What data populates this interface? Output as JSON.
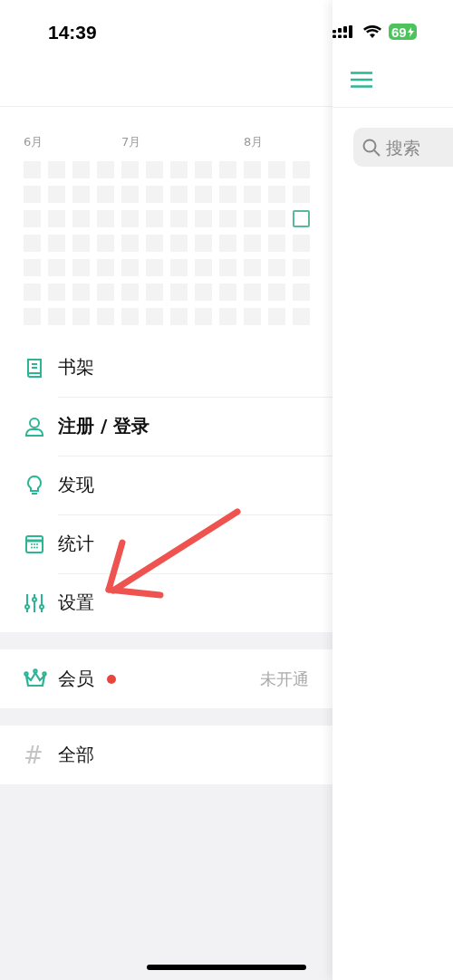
{
  "status_bar": {
    "time": "14:39",
    "battery": "69",
    "charging": true
  },
  "heatmap": {
    "weeks": [
      {
        "month_label": "6月",
        "days": [
          {
            "today": false
          },
          {
            "today": false
          },
          {
            "today": false
          },
          {
            "today": false
          },
          {
            "today": false
          },
          {
            "today": false
          },
          {
            "today": false
          }
        ]
      },
      {
        "days": [
          {
            "today": false
          },
          {
            "today": false
          },
          {
            "today": false
          },
          {
            "today": false
          },
          {
            "today": false
          },
          {
            "today": false
          },
          {
            "today": false
          }
        ]
      },
      {
        "days": [
          {
            "today": false
          },
          {
            "today": false
          },
          {
            "today": false
          },
          {
            "today": false
          },
          {
            "today": false
          },
          {
            "today": false
          },
          {
            "today": false
          }
        ]
      },
      {
        "days": [
          {
            "today": false
          },
          {
            "today": false
          },
          {
            "today": false
          },
          {
            "today": false
          },
          {
            "today": false
          },
          {
            "today": false
          },
          {
            "today": false
          }
        ]
      },
      {
        "month_label": "7月",
        "days": [
          {
            "today": false
          },
          {
            "today": false
          },
          {
            "today": false
          },
          {
            "today": false
          },
          {
            "today": false
          },
          {
            "today": false
          },
          {
            "today": false
          }
        ]
      },
      {
        "days": [
          {
            "today": false
          },
          {
            "today": false
          },
          {
            "today": false
          },
          {
            "today": false
          },
          {
            "today": false
          },
          {
            "today": false
          },
          {
            "today": false
          }
        ]
      },
      {
        "days": [
          {
            "today": false
          },
          {
            "today": false
          },
          {
            "today": false
          },
          {
            "today": false
          },
          {
            "today": false
          },
          {
            "today": false
          },
          {
            "today": false
          }
        ]
      },
      {
        "days": [
          {
            "today": false
          },
          {
            "today": false
          },
          {
            "today": false
          },
          {
            "today": false
          },
          {
            "today": false
          },
          {
            "today": false
          },
          {
            "today": false
          }
        ]
      },
      {
        "days": [
          {
            "today": false
          },
          {
            "today": false
          },
          {
            "today": false
          },
          {
            "today": false
          },
          {
            "today": false
          },
          {
            "today": false
          },
          {
            "today": false
          }
        ]
      },
      {
        "month_label": "8月",
        "days": [
          {
            "today": false
          },
          {
            "today": false
          },
          {
            "today": false
          },
          {
            "today": false
          },
          {
            "today": false
          },
          {
            "today": false
          },
          {
            "today": false
          }
        ]
      },
      {
        "days": [
          {
            "today": false
          },
          {
            "today": false
          },
          {
            "today": false
          },
          {
            "today": false
          },
          {
            "today": false
          },
          {
            "today": false
          },
          {
            "today": false
          }
        ]
      },
      {
        "days": [
          {
            "today": false
          },
          {
            "today": false
          },
          {
            "today": true
          },
          {
            "today": false
          },
          {
            "today": false
          },
          {
            "today": false
          },
          {
            "today": false
          }
        ]
      }
    ]
  },
  "menu_sections": [
    {
      "items": [
        {
          "kind": "book",
          "label": "书架",
          "emphasized": false
        },
        {
          "kind": "person",
          "label": "注册 / 登录",
          "emphasized": true
        },
        {
          "kind": "bulb",
          "label": "发现",
          "emphasized": false
        },
        {
          "kind": "calendar",
          "label": "统计",
          "emphasized": false
        },
        {
          "kind": "sliders",
          "label": "设置",
          "emphasized": false
        }
      ]
    },
    {
      "items": [
        {
          "kind": "crown",
          "label": "会员",
          "emphasized": false,
          "color": "#e8453c",
          "value": "未开通"
        }
      ]
    },
    {
      "items": [
        {
          "kind": "hash",
          "symbol": "#",
          "label": "全部",
          "emphasized": false
        }
      ]
    }
  ],
  "main_panel": {
    "search": {
      "placeholder": "搜索"
    }
  },
  "annotation": {
    "kind": "arrow"
  }
}
